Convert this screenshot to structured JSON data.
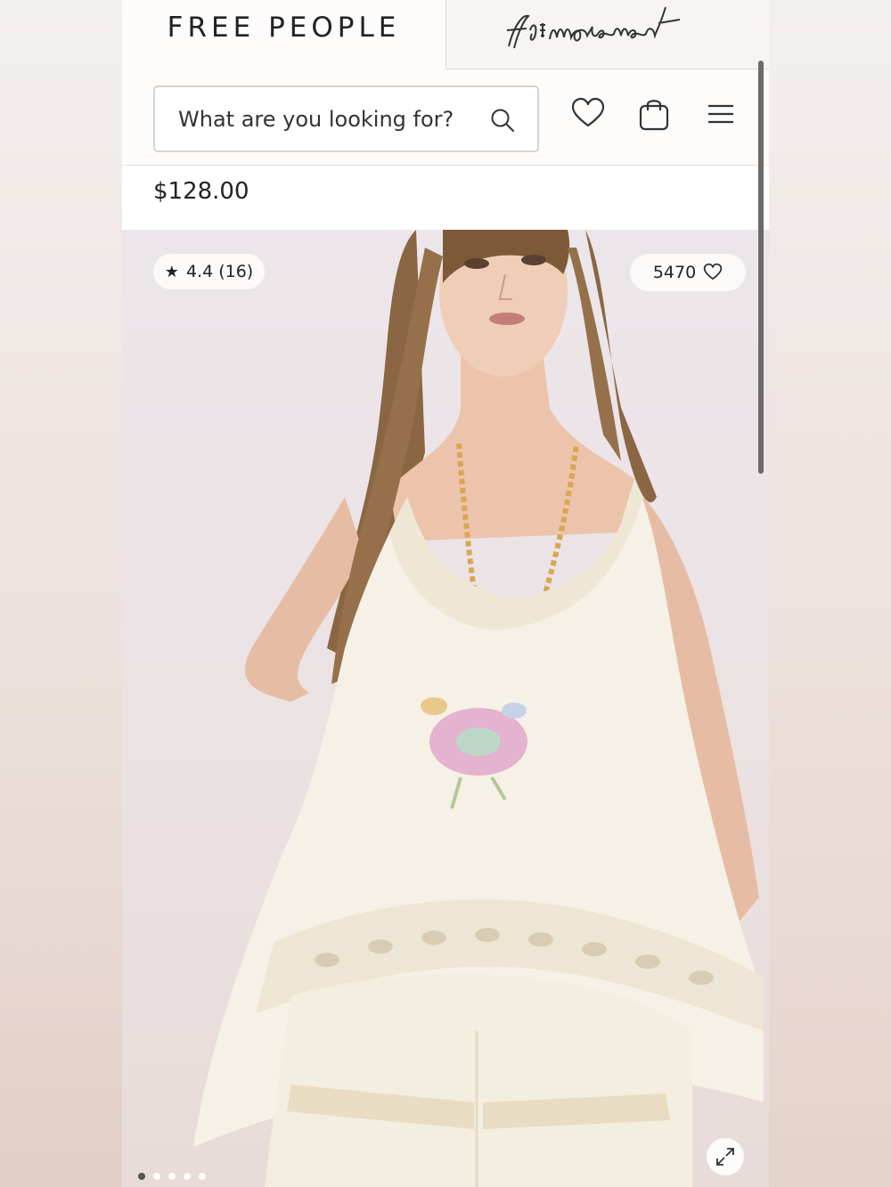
{
  "brand": {
    "primary": "FREE PEOPLE",
    "secondary": "fp movement"
  },
  "search": {
    "placeholder": "What are you looking for?",
    "icon": "search-icon"
  },
  "header_icons": [
    "heart-icon",
    "shopping-bag-icon",
    "hamburger-menu-icon"
  ],
  "product": {
    "price": "$128.00"
  },
  "gallery": {
    "rating_star": "★",
    "rating_text": "4.4 (16)",
    "likes_count": "5470",
    "image_count": 5,
    "active_index": 0
  },
  "colors": {
    "text": "#222222",
    "background": "#fdfcfb",
    "border": "#d7d3cf"
  }
}
